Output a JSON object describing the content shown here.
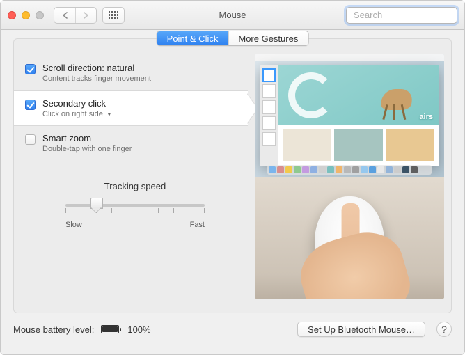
{
  "window": {
    "title": "Mouse"
  },
  "toolbar": {
    "search_placeholder": "Search"
  },
  "tabs": [
    {
      "label": "Point & Click",
      "active": true
    },
    {
      "label": "More Gestures",
      "active": false
    }
  ],
  "options": [
    {
      "key": "scroll_direction",
      "title": "Scroll direction: natural",
      "subtitle": "Content tracks finger movement",
      "checked": true,
      "has_dropdown": false,
      "selected": false
    },
    {
      "key": "secondary_click",
      "title": "Secondary click",
      "subtitle": "Click on right side",
      "checked": true,
      "has_dropdown": true,
      "selected": true
    },
    {
      "key": "smart_zoom",
      "title": "Smart zoom",
      "subtitle": "Double-tap with one finger",
      "checked": false,
      "has_dropdown": false,
      "selected": false
    }
  ],
  "tracking": {
    "label": "Tracking speed",
    "min_label": "Slow",
    "max_label": "Fast",
    "ticks": 10,
    "value_index": 2
  },
  "footer": {
    "battery_label_prefix": "Mouse battery level:",
    "battery_percent": "100%",
    "battery_fill": 100,
    "bluetooth_button": "Set Up Bluetooth Mouse…",
    "help": "?"
  },
  "colors": {
    "accent": "#2f81f0",
    "window_bg": "#f0f0f0",
    "card_bg": "#ececec"
  },
  "dock_colors": [
    "#7bb5ec",
    "#d98e8e",
    "#f2c94c",
    "#8fc98f",
    "#c49be0",
    "#8fb0e2",
    "#d0d0d0",
    "#7ac0be",
    "#f0b56b",
    "#b8b8b8",
    "#a0a0a0",
    "#96c8ee",
    "#5aa0df",
    "#e8e8e8",
    "#93b4d9",
    "#cccccc",
    "#3b5366",
    "#5f5f5f"
  ]
}
